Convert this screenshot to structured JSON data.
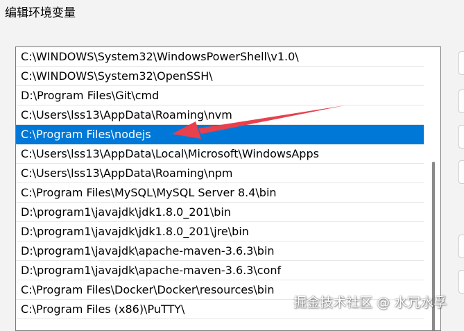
{
  "window": {
    "title": "编辑环境变量"
  },
  "path_list": {
    "items": [
      "C:\\WINDOWS\\System32\\WindowsPowerShell\\v1.0\\",
      "C:\\WINDOWS\\System32\\OpenSSH\\",
      "D:\\Program Files\\Git\\cmd",
      "C:\\Users\\lss13\\AppData\\Roaming\\nvm",
      "C:\\Program Files\\nodejs",
      "C:\\Users\\lss13\\AppData\\Local\\Microsoft\\WindowsApps",
      "C:\\Users\\lss13\\AppData\\Roaming\\npm",
      "C:\\Program Files\\MySQL\\MySQL Server 8.4\\bin",
      "D:\\program1\\javajdk\\jdk1.8.0_201\\bin",
      "D:\\program1\\javajdk\\jdk1.8.0_201\\jre\\bin",
      "D:\\program1\\javajdk\\apache-maven-3.6.3\\bin",
      "D:\\program1\\javajdk\\apache-maven-3.6.3\\conf",
      "C:\\Program Files\\Docker\\Docker\\resources\\bin",
      "C:\\Program Files (x86)\\PuTTY\\"
    ],
    "selected_index": 4
  },
  "annotation": {
    "arrow_color": "#e8404d",
    "arrow_icon": "red-arrow-icon"
  },
  "colors": {
    "selection": "#0078d7"
  },
  "watermark": {
    "text": "掘金技术社区 @ 水冗水孚"
  }
}
